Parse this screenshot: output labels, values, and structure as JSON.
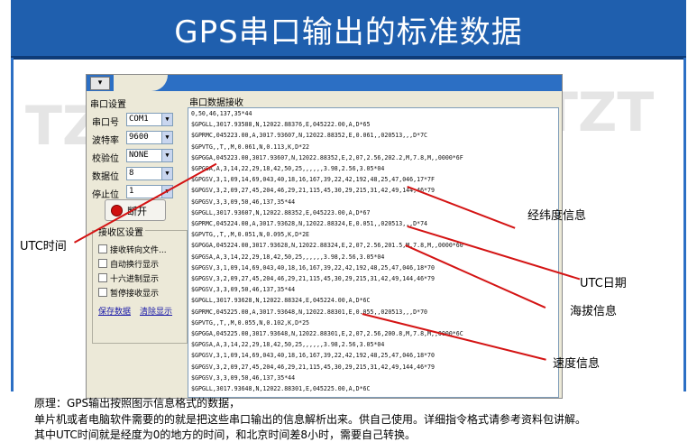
{
  "banner": {
    "title": "GPS串口输出的标准数据"
  },
  "window": {
    "toolbar_icon": "▾",
    "settings": {
      "title": "串口设置",
      "port_label": "串口号",
      "port_value": "COM1",
      "baud_label": "波特率",
      "baud_value": "9600",
      "parity_label": "校验位",
      "parity_value": "NONE",
      "data_label": "数据位",
      "data_value": "8",
      "stop_label": "停止位",
      "stop_value": "1",
      "open_button": "断开"
    },
    "recv_settings": {
      "title": "接收区设置",
      "options": [
        "接收转向文件...",
        "自动换行显示",
        "十六进制显示",
        "暂停接收显示"
      ],
      "save_link": "保存数据",
      "clear_link": "清除显示"
    },
    "recv_area": {
      "title": "串口数据接收",
      "lines": [
        "0,50,46,137,35*44",
        "$GPGLL,3017.93588,N,12022.88376,E,045222.00,A,D*65",
        "$GPRMC,045223.00,A,3017.93607,N,12022.88352,E,0.061,,020513,,,D*7C",
        "$GPVTG,,T,,M,0.061,N,0.113,K,D*22",
        "$GPGGA,045223.00,3017.93607,N,12022.88352,E,2,07,2.56,202.2,M,7.8,M,,0000*6F",
        "$GPGSA,A,3,14,22,29,18,42,50,25,,,,,,3.98,2.56,3.05*04",
        "$GPGSV,3,1,09,14,69,043,40,18,16,167,39,22,42,192,48,25,47,046,17*7F",
        "$GPGSV,3,2,09,27,45,204,46,29,21,115,45,30,29,215,31,42,49,144,46*79",
        "$GPGSV,3,3,09,50,46,137,35*44",
        "$GPGLL,3017.93607,N,12022.88352,E,045223.00,A,D*67",
        "$GPRMC,045224.00,A,3017.93628,N,12022.88324,E,0.051,,020513,,,D*74",
        "$GPVTG,,T,,M,0.051,N,0.095,K,D*2E",
        "$GPGGA,045224.00,3017.93628,N,12022.88324,E,2,07,2.56,201.5,M,7.8,M,,0000*60",
        "$GPGSA,A,3,14,22,29,18,42,50,25,,,,,,3.98,2.56,3.05*04",
        "$GPGSV,3,1,09,14,69,043,40,18,16,167,39,22,42,192,48,25,47,046,18*70",
        "$GPGSV,3,2,09,27,45,204,46,29,21,115,45,30,29,215,31,42,49,144,46*79",
        "$GPGSV,3,3,09,50,46,137,35*44",
        "$GPGLL,3017.93628,N,12022.88324,E,045224.00,A,D*6C",
        "$GPRMC,045225.00,A,3017.93648,N,12022.88301,E,0.055,,020513,,,D*70",
        "$GPVTG,,T,,M,0.055,N,0.102,K,D*25",
        "$GPGGA,045225.00,3017.93648,N,12022.88301,E,2,07,2.56,200.8,M,7.8,M,,0000*6C",
        "$GPGSA,A,3,14,22,29,18,42,50,25,,,,,,3.98,2.56,3.05*04",
        "$GPGSV,3,1,09,14,69,043,40,18,16,167,39,22,42,192,48,25,47,046,18*70",
        "$GPGSV,3,2,09,27,45,204,46,29,21,115,45,30,29,215,31,42,49,144,46*79",
        "$GPGSV,3,3,09,50,46,137,35*44",
        "$GPGLL,3017.93648,N,12022.88301,E,045225.00,A,D*6C"
      ]
    }
  },
  "annotations": {
    "latlon": "经纬度信息",
    "utc_time": "UTC时间",
    "utc_date": "UTC日期",
    "altitude": "海拔信息",
    "speed": "速度信息"
  },
  "notes": [
    "原理：GPS输出按照图示信息格式的数据，",
    "单片机或者电脑软件需要的的就是把这些串口输出的信息解析出来。供自己使用。详细指令格式请参考资料包讲解。",
    "其中UTC时间就是经度为0的地方的时间，和北京时间差8小时，需要自己转换。"
  ],
  "watermarks": [
    "TZT",
    "TZT"
  ],
  "colors": {
    "banner": "#1f5fae",
    "arrow": "#d41414",
    "window_bg": "#ece9d8"
  }
}
